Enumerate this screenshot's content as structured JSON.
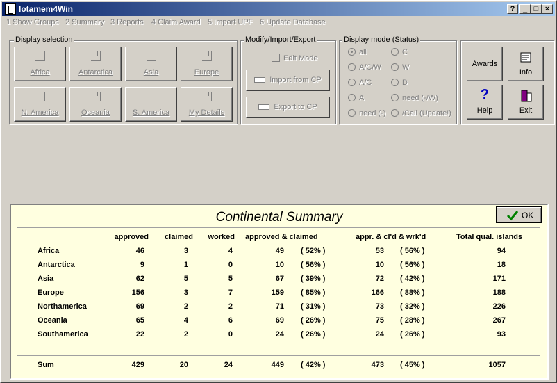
{
  "window": {
    "title": "Iotamem4Win"
  },
  "titlebar_buttons": [
    "?",
    "_",
    "□",
    "×"
  ],
  "menu": [
    "1 Show Groups",
    "2 Summary",
    "3 Reports",
    "4 Claim Award",
    "5 Import UPF",
    "6 Update Database"
  ],
  "display_selection": {
    "label": "Display selection",
    "buttons": [
      "Africa",
      "Antarctica",
      "Asia",
      "Europe",
      "N. America",
      "Oceania",
      "S. America",
      "My Details"
    ]
  },
  "modify": {
    "label": "Modify/Import/Export",
    "edit_mode": "Edit Mode",
    "import_label": "Import from CP",
    "export_label": "Export to CP"
  },
  "display_mode": {
    "label": "Display mode (Status)",
    "options": [
      "all",
      "C",
      "A/C/W",
      "W",
      "A/C",
      "D",
      "A",
      "need (-/W)",
      "need (-)",
      "/Call (Update!)"
    ],
    "selected": "all"
  },
  "actions": {
    "awards": "Awards",
    "info": "Info",
    "help": "Help",
    "exit": "Exit"
  },
  "summary": {
    "title": "Continental Summary",
    "ok_label": "OK",
    "headers": {
      "approved": "approved",
      "claimed": "claimed",
      "worked": "worked",
      "approved_claimed": "approved & claimed",
      "appr_cld_wrkd": "appr. & cl'd & wrk'd",
      "total": "Total qual. islands"
    },
    "rows": [
      {
        "name": "Africa",
        "approved": "46",
        "claimed": "3",
        "worked": "4",
        "ac": "49",
        "ac_pct": "( 52% )",
        "acw": "53",
        "acw_pct": "( 56% )",
        "total": "94"
      },
      {
        "name": "Antarctica",
        "approved": "9",
        "claimed": "1",
        "worked": "0",
        "ac": "10",
        "ac_pct": "( 56% )",
        "acw": "10",
        "acw_pct": "( 56% )",
        "total": "18"
      },
      {
        "name": "Asia",
        "approved": "62",
        "claimed": "5",
        "worked": "5",
        "ac": "67",
        "ac_pct": "( 39% )",
        "acw": "72",
        "acw_pct": "( 42% )",
        "total": "171"
      },
      {
        "name": "Europe",
        "approved": "156",
        "claimed": "3",
        "worked": "7",
        "ac": "159",
        "ac_pct": "( 85% )",
        "acw": "166",
        "acw_pct": "( 88% )",
        "total": "188"
      },
      {
        "name": "Northamerica",
        "approved": "69",
        "claimed": "2",
        "worked": "2",
        "ac": "71",
        "ac_pct": "( 31% )",
        "acw": "73",
        "acw_pct": "( 32% )",
        "total": "226"
      },
      {
        "name": "Oceania",
        "approved": "65",
        "claimed": "4",
        "worked": "6",
        "ac": "69",
        "ac_pct": "( 26% )",
        "acw": "75",
        "acw_pct": "( 28% )",
        "total": "267"
      },
      {
        "name": "Southamerica",
        "approved": "22",
        "claimed": "2",
        "worked": "0",
        "ac": "24",
        "ac_pct": "( 26% )",
        "acw": "24",
        "acw_pct": "( 26% )",
        "total": "93"
      }
    ],
    "sum": {
      "name": "Sum",
      "approved": "429",
      "claimed": "20",
      "worked": "24",
      "ac": "449",
      "ac_pct": "( 42% )",
      "acw": "473",
      "acw_pct": "( 45% )",
      "total": "1057"
    }
  }
}
